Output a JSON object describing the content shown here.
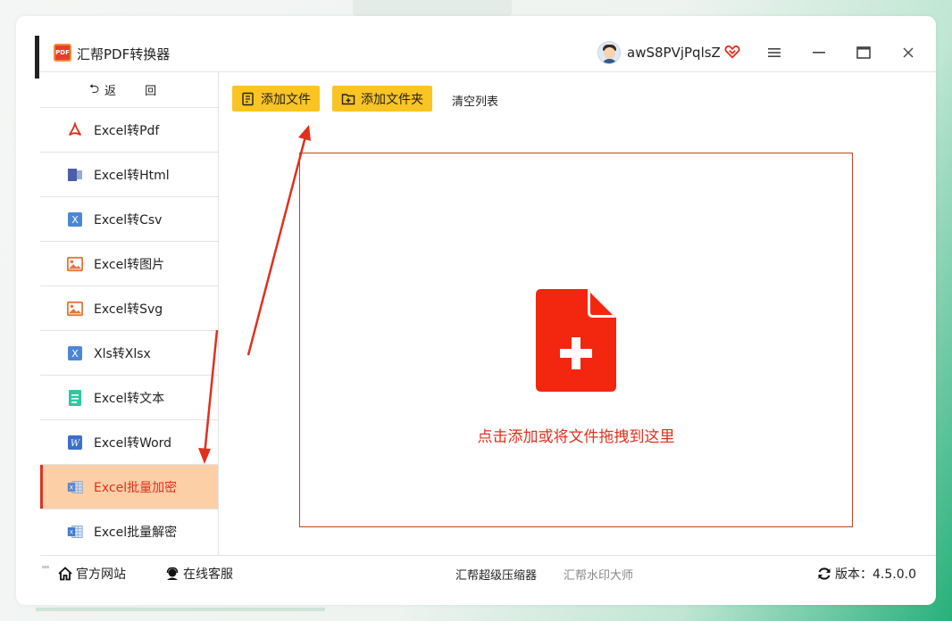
{
  "app": {
    "title": "汇帮PDF转换器",
    "logo_text": "PDF",
    "username": "awS8PVjPqlsZ"
  },
  "sidebar": {
    "back_label": "返 回",
    "items": [
      {
        "label": "Excel转Pdf",
        "icon": "pdf-icon"
      },
      {
        "label": "Excel转Html",
        "icon": "html-icon"
      },
      {
        "label": "Excel转Csv",
        "icon": "excel-icon"
      },
      {
        "label": "Excel转图片",
        "icon": "image-icon"
      },
      {
        "label": "Excel转Svg",
        "icon": "image-icon"
      },
      {
        "label": "Xls转Xlsx",
        "icon": "excel-icon"
      },
      {
        "label": "Excel转文本",
        "icon": "text-file-icon"
      },
      {
        "label": "Excel转Word",
        "icon": "word-icon"
      },
      {
        "label": "Excel批量加密",
        "icon": "excel-sheet-icon",
        "active": true
      },
      {
        "label": "Excel批量解密",
        "icon": "excel-sheet-icon"
      }
    ]
  },
  "toolbar": {
    "add_file": "添加文件",
    "add_folder": "添加文件夹",
    "clear_list": "清空列表"
  },
  "drop_area": {
    "hint": "点击添加或将文件拖拽到这里"
  },
  "footer": {
    "website": "官方网站",
    "support": "在线客服",
    "compressor": "汇帮超级压缩器",
    "watermark": "汇帮水印大师",
    "version": "版本：4.5.0.0"
  },
  "colors": {
    "accent": "#e0301e",
    "button": "#fbc422",
    "active_bg": "#fccfa7"
  }
}
